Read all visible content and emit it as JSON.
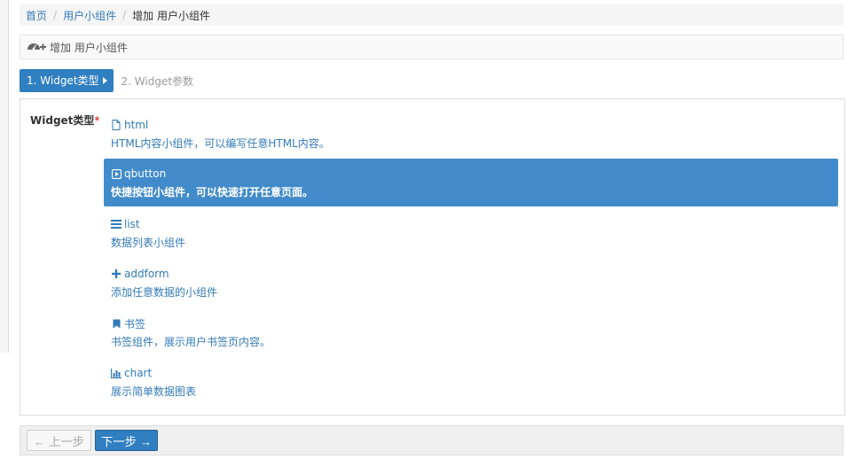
{
  "breadcrumb": {
    "items": [
      "首页",
      "用户小组件"
    ],
    "current": "增加 用户小组件"
  },
  "panel": {
    "icon": "dashboard-plus-icon",
    "title": "增加 用户小组件"
  },
  "steps": {
    "active": "1. Widget类型",
    "next": "2. Widget参数"
  },
  "form": {
    "label": "Widget类型",
    "required_mark": "*",
    "selected_index": 1,
    "options": [
      {
        "icon": "file-icon",
        "title": "html",
        "desc": "HTML内容小组件，可以编写任意HTML内容。"
      },
      {
        "icon": "play-square-icon",
        "title": "qbutton",
        "desc": "快捷按钮小组件，可以快速打开任意页面。"
      },
      {
        "icon": "list-icon",
        "title": "list",
        "desc": "数据列表小组件"
      },
      {
        "icon": "plus-icon",
        "title": "addform",
        "desc": "添加任意数据的小组件"
      },
      {
        "icon": "bookmark-icon",
        "title": "书签",
        "desc": "书签组件，展示用户书签页内容。"
      },
      {
        "icon": "bar-chart-icon",
        "title": "chart",
        "desc": "展示简单数据图表"
      }
    ]
  },
  "footer": {
    "prev_label": "← 上一步",
    "next_label": "下一步 →"
  },
  "colors": {
    "primary": "#428bca",
    "link": "#337ab7",
    "required": "#cc0000"
  }
}
